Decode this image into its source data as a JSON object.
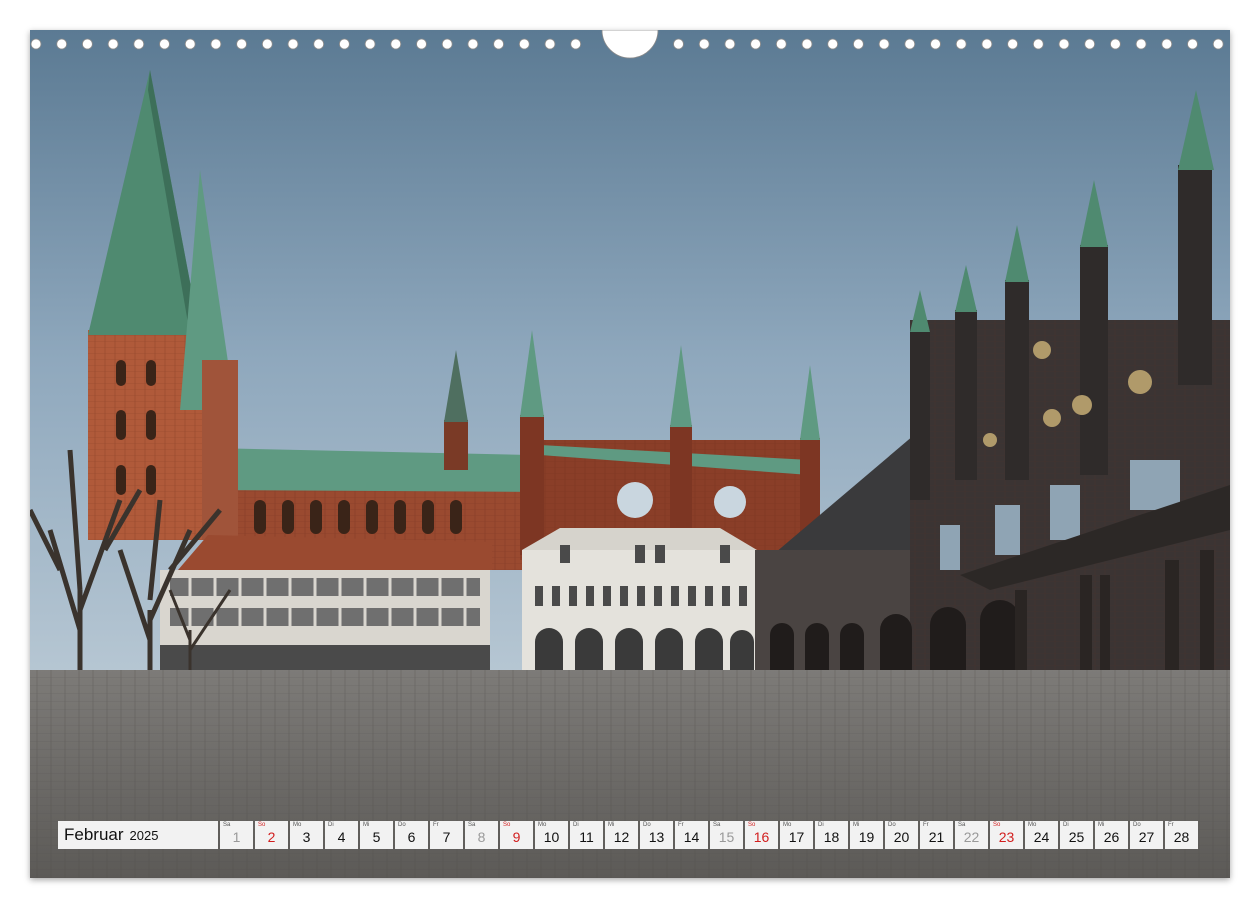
{
  "calendar": {
    "month": "Februar",
    "year": "2025",
    "days": [
      {
        "wd": "Sa",
        "num": "1",
        "kind": "sat"
      },
      {
        "wd": "So",
        "num": "2",
        "kind": "sun"
      },
      {
        "wd": "Mo",
        "num": "3",
        "kind": "wk"
      },
      {
        "wd": "Di",
        "num": "4",
        "kind": "wk"
      },
      {
        "wd": "Mi",
        "num": "5",
        "kind": "wk"
      },
      {
        "wd": "Do",
        "num": "6",
        "kind": "wk"
      },
      {
        "wd": "Fr",
        "num": "7",
        "kind": "wk"
      },
      {
        "wd": "Sa",
        "num": "8",
        "kind": "sat"
      },
      {
        "wd": "So",
        "num": "9",
        "kind": "sun"
      },
      {
        "wd": "Mo",
        "num": "10",
        "kind": "wk"
      },
      {
        "wd": "Di",
        "num": "11",
        "kind": "wk"
      },
      {
        "wd": "Mi",
        "num": "12",
        "kind": "wk"
      },
      {
        "wd": "Do",
        "num": "13",
        "kind": "wk"
      },
      {
        "wd": "Fr",
        "num": "14",
        "kind": "wk"
      },
      {
        "wd": "Sa",
        "num": "15",
        "kind": "sat"
      },
      {
        "wd": "So",
        "num": "16",
        "kind": "sun"
      },
      {
        "wd": "Mo",
        "num": "17",
        "kind": "wk"
      },
      {
        "wd": "Di",
        "num": "18",
        "kind": "wk"
      },
      {
        "wd": "Mi",
        "num": "19",
        "kind": "wk"
      },
      {
        "wd": "Do",
        "num": "20",
        "kind": "wk"
      },
      {
        "wd": "Fr",
        "num": "21",
        "kind": "wk"
      },
      {
        "wd": "Sa",
        "num": "22",
        "kind": "sat"
      },
      {
        "wd": "So",
        "num": "23",
        "kind": "sun"
      },
      {
        "wd": "Mo",
        "num": "24",
        "kind": "wk"
      },
      {
        "wd": "Di",
        "num": "25",
        "kind": "wk"
      },
      {
        "wd": "Mi",
        "num": "26",
        "kind": "wk"
      },
      {
        "wd": "Do",
        "num": "27",
        "kind": "wk"
      },
      {
        "wd": "Fr",
        "num": "28",
        "kind": "wk"
      }
    ]
  },
  "colors": {
    "sunday": "#d21e1e",
    "saturday": "#999999",
    "cell_bg": "#f2f2f2"
  },
  "photo": {
    "subject": "market-square-with-town-hall-and-church"
  }
}
